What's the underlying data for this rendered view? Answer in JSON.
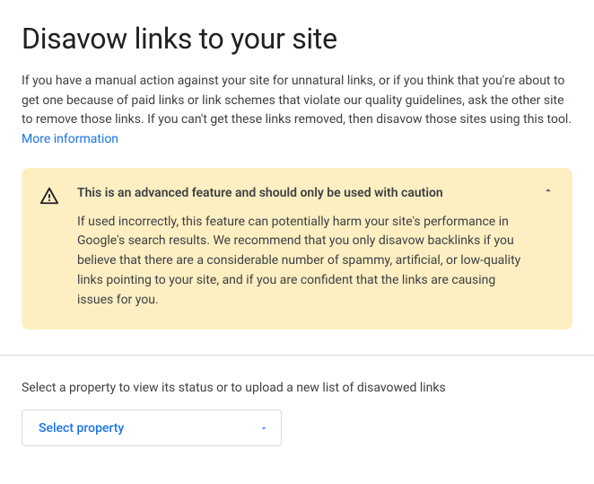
{
  "page": {
    "title": "Disavow links to your site",
    "intro": "If you have a manual action against your site for unnatural links, or if you think that you're about to get one because of paid links or link schemes that violate our quality guidelines, ask the other site to remove those links. If you can't get these links removed, then disavow those sites using this tool. ",
    "more_info": "More information"
  },
  "warning": {
    "title": "This is an advanced feature and should only be used with caution",
    "body": "If used incorrectly, this feature can potentially harm your site's performance in Google's search results. We recommend that you only disavow backlinks if you believe that there are a considerable number of spammy, artificial, or low-quality links pointing to your site, and if you are confident that the links are causing issues for you."
  },
  "property": {
    "label": "Select a property to view its status or to upload a new list of disavowed links",
    "select_text": "Select property"
  }
}
